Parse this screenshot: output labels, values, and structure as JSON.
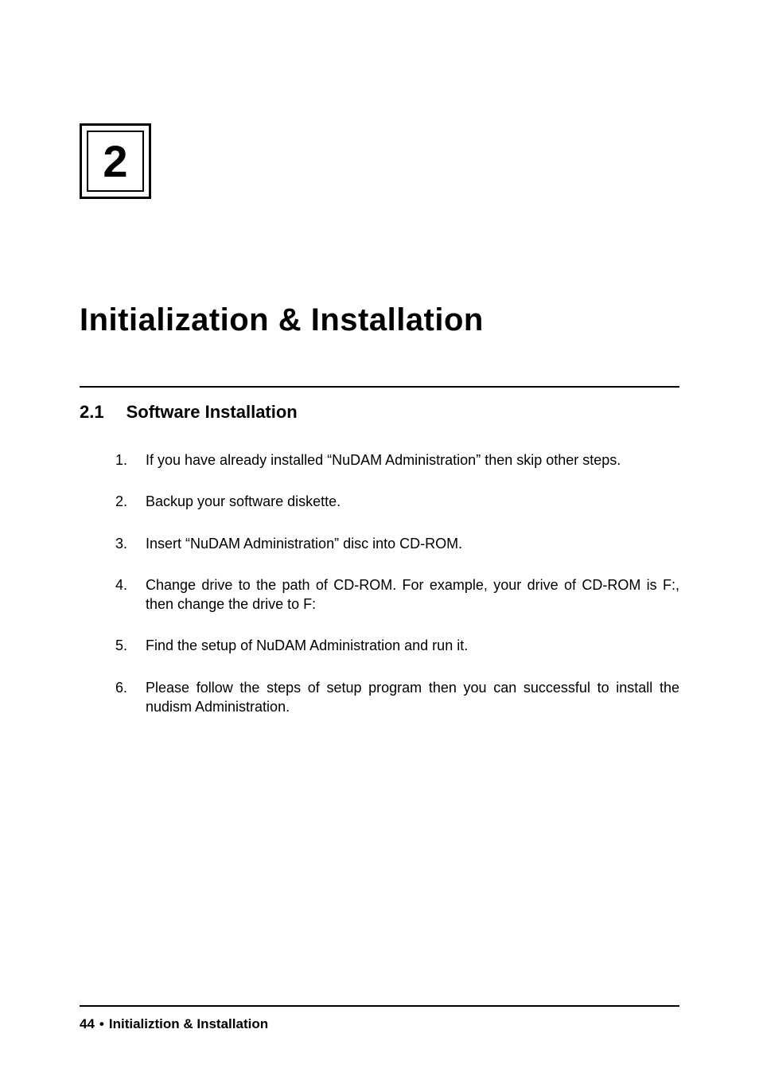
{
  "chapter": {
    "number": "2",
    "title": "Initialization & Installation"
  },
  "section": {
    "number": "2.1",
    "title": "Software Installation"
  },
  "steps": [
    {
      "num": "1.",
      "text": "If you have already installed “NuDAM Administration” then skip other steps."
    },
    {
      "num": "2.",
      "text": "Backup your software diskette."
    },
    {
      "num": "3.",
      "text": "Insert “NuDAM Administration” disc into CD-ROM."
    },
    {
      "num": "4.",
      "text": "Change drive to the path of CD-ROM. For example, your drive of CD-ROM is F:, then change the drive to F:"
    },
    {
      "num": "5.",
      "text": "Find the setup of NuDAM Administration and run it."
    },
    {
      "num": "6.",
      "text": "Please follow the steps of setup program then you can successful to install the nudism Administration."
    }
  ],
  "footer": {
    "page_number": "44",
    "bullet": "•",
    "section_name": "Initializtion & Installation"
  }
}
